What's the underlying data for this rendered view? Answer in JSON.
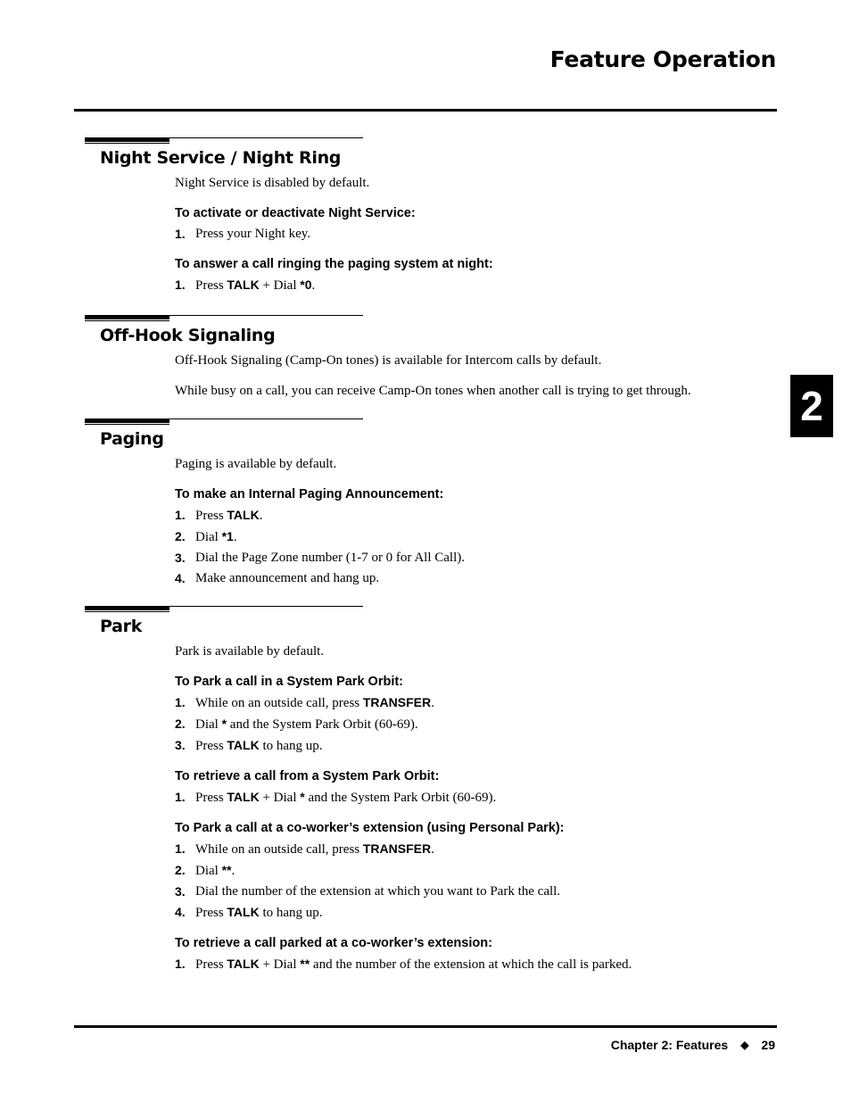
{
  "header": {
    "title": "Feature Operation"
  },
  "chapter_tab": "2",
  "footer": {
    "chapter": "Chapter 2: Features",
    "separator": "◆",
    "page": "29"
  },
  "sections": [
    {
      "title": "Night Service / Night Ring",
      "paragraphs": [
        "Night Service is disabled by default."
      ],
      "procedures": [
        {
          "heading": "To activate or deactivate Night Service:",
          "steps": [
            {
              "num": "1.",
              "parts": [
                {
                  "t": "Press your Night key."
                }
              ]
            }
          ]
        },
        {
          "heading": "To answer a call ringing the paging system at night:",
          "steps": [
            {
              "num": "1.",
              "parts": [
                {
                  "t": "Press "
                },
                {
                  "k": "TALK"
                },
                {
                  "t": " + Dial "
                },
                {
                  "k": "*0"
                },
                {
                  "t": "."
                }
              ]
            }
          ]
        }
      ]
    },
    {
      "title": "Off-Hook Signaling",
      "paragraphs": [
        "Off-Hook Signaling (Camp-On tones) is available for Intercom calls by default.",
        "While busy on a call, you can receive Camp-On tones when another call is trying to get through."
      ],
      "procedures": []
    },
    {
      "title": "Paging",
      "paragraphs": [
        "Paging is available by default."
      ],
      "procedures": [
        {
          "heading": "To make an Internal Paging Announcement:",
          "steps": [
            {
              "num": "1.",
              "parts": [
                {
                  "t": "Press "
                },
                {
                  "k": "TALK"
                },
                {
                  "t": "."
                }
              ]
            },
            {
              "num": "2.",
              "parts": [
                {
                  "t": "Dial "
                },
                {
                  "k": "*1"
                },
                {
                  "t": "."
                }
              ]
            },
            {
              "num": "3.",
              "parts": [
                {
                  "t": "Dial the Page Zone number (1-7 or 0 for All Call)."
                }
              ]
            },
            {
              "num": "4.",
              "parts": [
                {
                  "t": "Make announcement and hang up."
                }
              ]
            }
          ]
        }
      ]
    },
    {
      "title": "Park",
      "paragraphs": [
        "Park is available by default."
      ],
      "procedures": [
        {
          "heading": "To Park a call in a System Park Orbit:",
          "steps": [
            {
              "num": "1.",
              "parts": [
                {
                  "t": "While on an outside call, press "
                },
                {
                  "k": "TRANSFER"
                },
                {
                  "t": "."
                }
              ]
            },
            {
              "num": "2.",
              "parts": [
                {
                  "t": "Dial "
                },
                {
                  "k": "*"
                },
                {
                  "t": " and the System Park Orbit (60-69)."
                }
              ]
            },
            {
              "num": "3.",
              "parts": [
                {
                  "t": "Press "
                },
                {
                  "k": "TALK"
                },
                {
                  "t": " to hang up."
                }
              ]
            }
          ]
        },
        {
          "heading": "To retrieve a call from a System Park Orbit:",
          "steps": [
            {
              "num": "1.",
              "parts": [
                {
                  "t": "Press "
                },
                {
                  "k": "TALK"
                },
                {
                  "t": " + Dial "
                },
                {
                  "k": "*"
                },
                {
                  "t": " and the System Park Orbit (60-69)."
                }
              ]
            }
          ]
        },
        {
          "heading": "To Park a call at a co-worker’s extension (using Personal Park):",
          "steps": [
            {
              "num": "1.",
              "parts": [
                {
                  "t": "While on an outside call, press "
                },
                {
                  "k": "TRANSFER"
                },
                {
                  "t": "."
                }
              ]
            },
            {
              "num": "2.",
              "parts": [
                {
                  "t": "Dial "
                },
                {
                  "k": "**"
                },
                {
                  "t": "."
                }
              ]
            },
            {
              "num": "3.",
              "parts": [
                {
                  "t": "Dial the number of the extension at which you want to Park the call."
                }
              ]
            },
            {
              "num": "4.",
              "parts": [
                {
                  "t": "Press "
                },
                {
                  "k": "TALK"
                },
                {
                  "t": " to hang up."
                }
              ]
            }
          ]
        },
        {
          "heading": "To retrieve a call parked at a co-worker’s extension:",
          "steps": [
            {
              "num": "1.",
              "parts": [
                {
                  "t": "Press "
                },
                {
                  "k": "TALK"
                },
                {
                  "t": " + Dial "
                },
                {
                  "k": "**"
                },
                {
                  "t": " and the number of the extension at which the call is parked."
                }
              ]
            }
          ]
        }
      ]
    }
  ]
}
